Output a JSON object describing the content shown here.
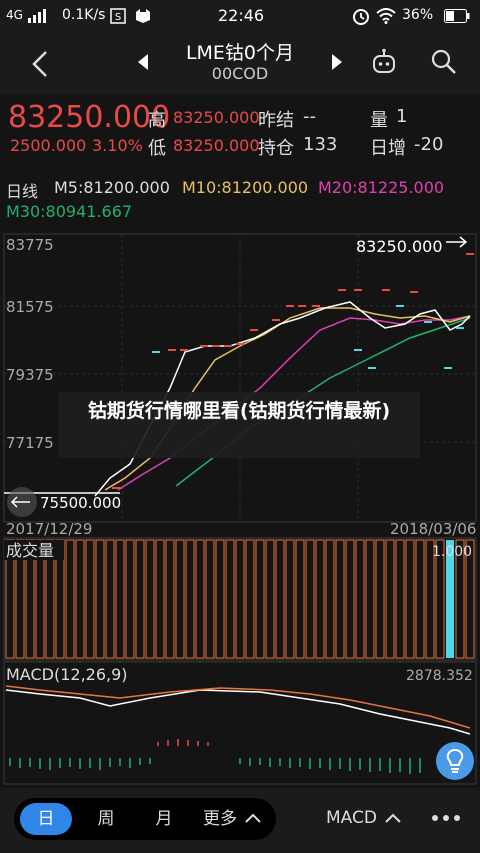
{
  "status_bar": {
    "network": "4G",
    "speed": "0.1K/s",
    "time": "22:46",
    "battery": "36%"
  },
  "header": {
    "title": "LME钴0个月",
    "code": "00COD"
  },
  "quote": {
    "price": "83250.000",
    "change": "2500.000",
    "change_pct": "3.10%",
    "high_label": "高",
    "high_value": "83250.000",
    "low_label": "低",
    "low_value": "83250.000",
    "prev_close_label": "昨结",
    "prev_close_value": "--",
    "open_interest_label": "持仓",
    "open_interest_value": "133",
    "volume_label": "量",
    "volume_value": "1",
    "daily_increase_label": "日增",
    "daily_increase_value": "-20"
  },
  "ma_legend": {
    "period": "日线",
    "m5": "M5:81200.000",
    "m10": "M10:81200.000",
    "m20": "M20:81225.000",
    "m30": "M30:80941.667"
  },
  "price_axis": [
    "83775",
    "81575",
    "79375",
    "77175"
  ],
  "last_price_tag": "83250.000",
  "low_price_tag": "75500.000",
  "date_start": "2017/12/29",
  "date_end": "2018/03/06",
  "volume_panel": {
    "title": "成交量",
    "max": "1.000"
  },
  "macd_panel": {
    "title": "MACD(12,26,9)",
    "max": "2878.352"
  },
  "overlay_text": "钴期货行情哪里看(钴期货行情最新)",
  "bottom_bar": {
    "tabs": [
      "日",
      "周",
      "月",
      "更多"
    ],
    "indicator": "MACD"
  },
  "colors": {
    "up": "#e84a4a",
    "down": "#4fd8e8",
    "m5": "#ffffff",
    "m10": "#e8c060",
    "m20": "#e040b0",
    "m30": "#22b070",
    "accent": "#2f86e8"
  }
}
